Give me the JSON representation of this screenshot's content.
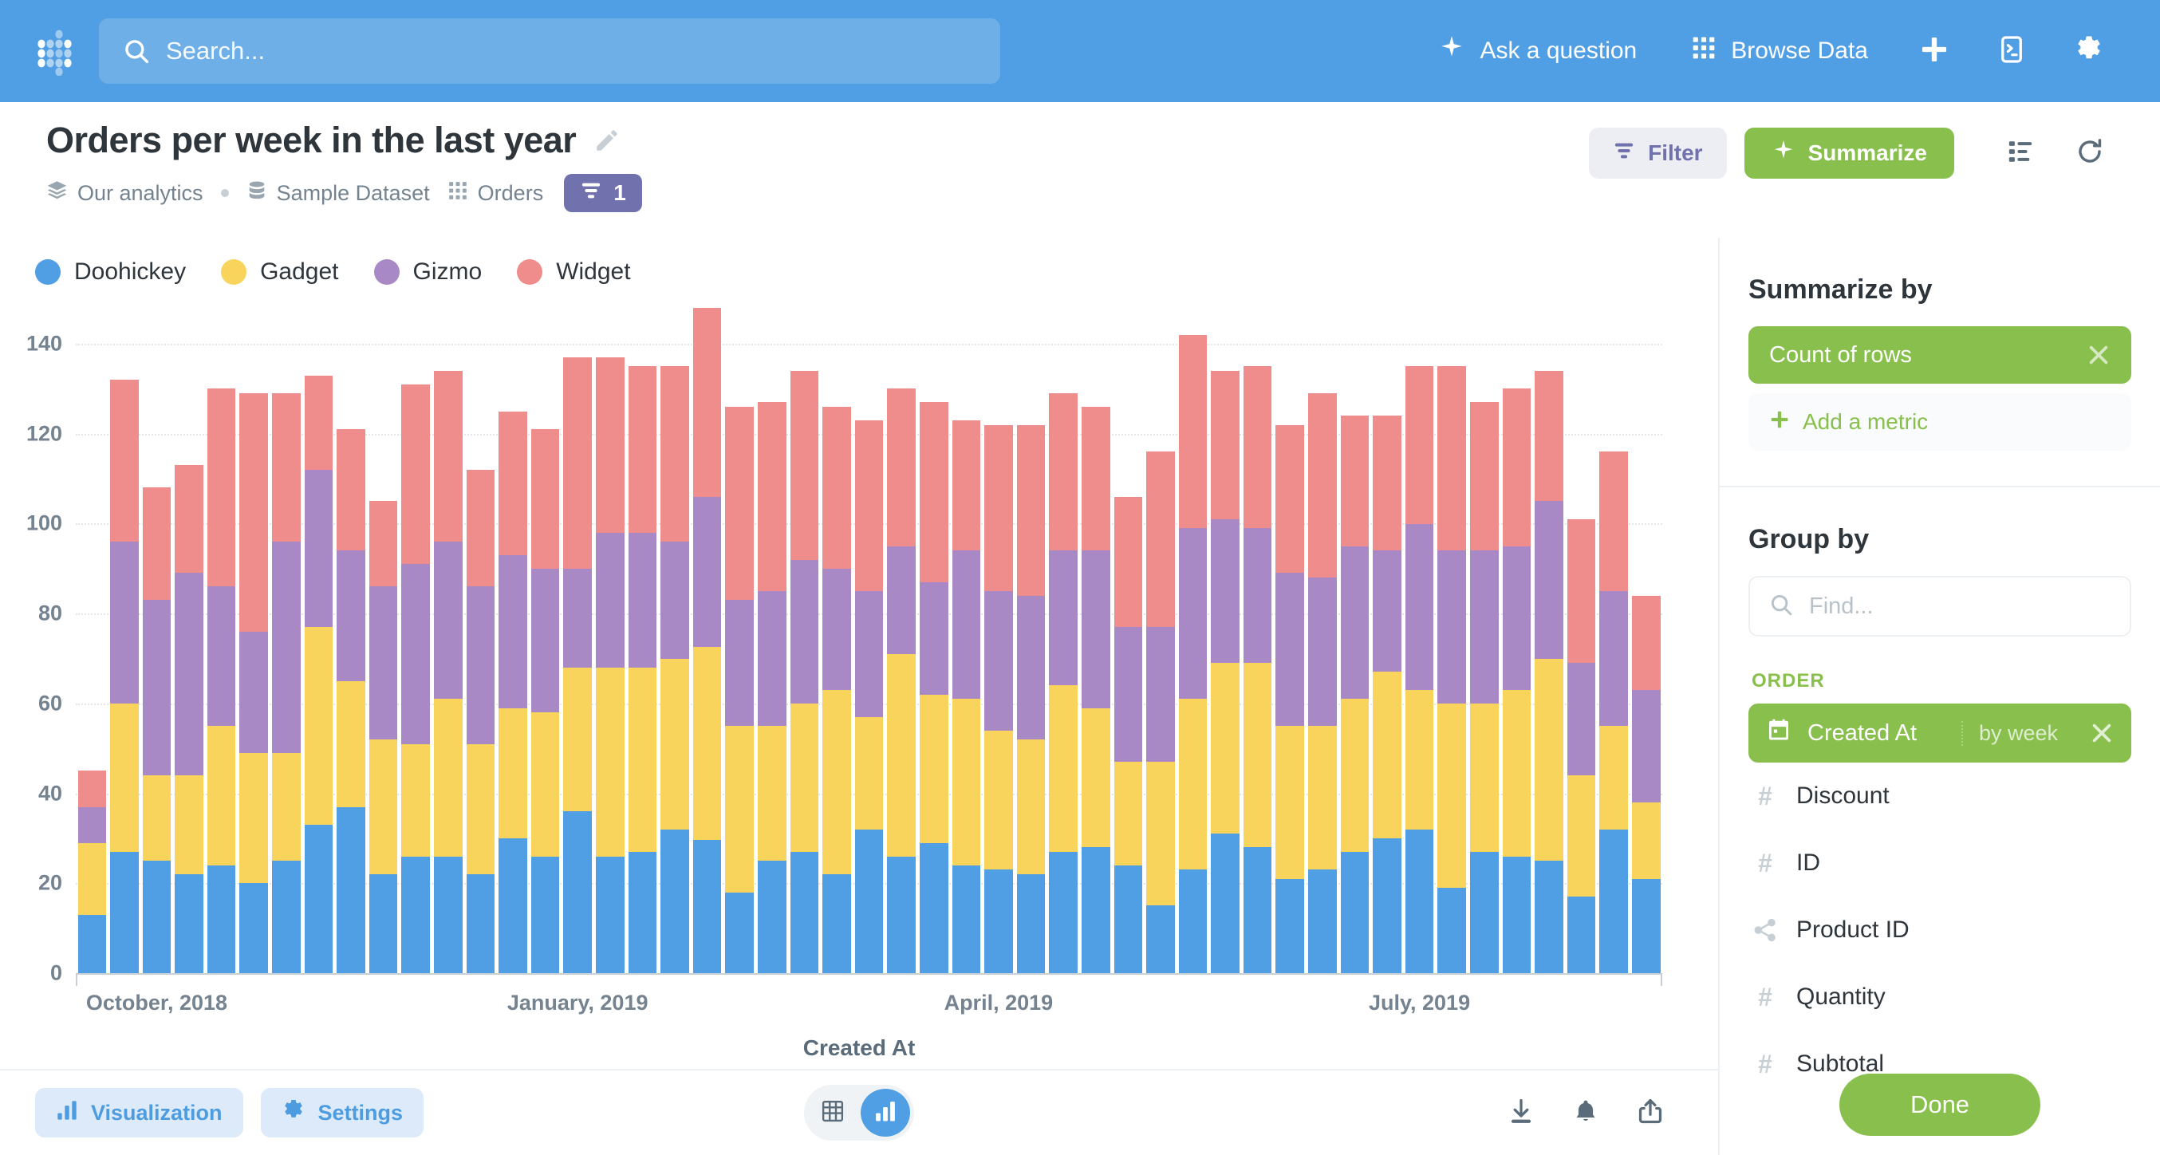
{
  "navbar": {
    "logo_icon": "metabase-dots-logo",
    "search": {
      "placeholder": "Search...",
      "value": "",
      "icon": "search-icon"
    },
    "ask_question": {
      "label": "Ask a question",
      "icon": "sparkle-icon"
    },
    "browse_data": {
      "label": "Browse Data",
      "icon": "grid-icon"
    },
    "new_icon": "plus-icon",
    "sql_icon": "console-icon",
    "settings_icon": "gear-icon",
    "bg_color": "#509EE3"
  },
  "header": {
    "title": "Orders per week in the last year",
    "edit_icon": "pencil-icon",
    "breadcrumbs": [
      {
        "label": "Our analytics",
        "icon": "collection-icon"
      },
      {
        "label": "Sample Dataset",
        "icon": "database-icon"
      },
      {
        "label": "Orders",
        "icon": "table-icon"
      }
    ],
    "filter_badge": {
      "count": "1",
      "icon": "filter-icon",
      "color": "#7172AD"
    },
    "filter_button": {
      "label": "Filter",
      "icon": "filter-icon"
    },
    "summarize_button": {
      "label": "Summarize",
      "icon": "sparkle-icon",
      "color": "#88BF4D"
    },
    "notebook_icon": "notebook-icon",
    "refresh_icon": "refresh-icon"
  },
  "chart_data": {
    "type": "bar",
    "stacked": true,
    "title": "",
    "xlabel": "Created At",
    "ylabel": "",
    "ylim": [
      0,
      148
    ],
    "yticks": [
      0,
      20,
      40,
      60,
      80,
      100,
      120,
      140
    ],
    "grid": true,
    "legend_position": "top-left",
    "xtick_labels": [
      "October, 2018",
      "January, 2019",
      "April, 2019",
      "July, 2019"
    ],
    "xtick_positions": [
      2,
      15,
      28,
      41
    ],
    "series": [
      {
        "name": "Doohickey",
        "color": "#509EE3",
        "values": [
          13,
          27,
          25,
          22,
          24,
          20,
          25,
          33,
          37,
          22,
          26,
          26,
          22,
          30,
          26,
          36,
          26,
          27,
          32,
          31,
          18,
          25,
          27,
          22,
          32,
          26,
          29,
          24,
          23,
          22,
          27,
          28,
          24,
          15,
          23,
          31,
          28,
          21,
          23,
          27,
          30,
          32,
          19,
          27,
          26,
          25,
          17,
          32,
          21
        ]
      },
      {
        "name": "Gadget",
        "color": "#F9D45C",
        "values": [
          16,
          33,
          19,
          22,
          31,
          29,
          24,
          44,
          28,
          30,
          25,
          35,
          29,
          29,
          32,
          32,
          42,
          41,
          38,
          45,
          37,
          30,
          33,
          41,
          25,
          45,
          33,
          37,
          31,
          30,
          37,
          31,
          23,
          32,
          38,
          38,
          41,
          34,
          32,
          34,
          37,
          31,
          41,
          33,
          37,
          45,
          27,
          23,
          17
        ]
      },
      {
        "name": "Gizmo",
        "color": "#A989C5",
        "values": [
          8,
          36,
          39,
          45,
          31,
          27,
          47,
          35,
          29,
          34,
          40,
          35,
          35,
          34,
          32,
          22,
          30,
          30,
          26,
          35,
          28,
          30,
          32,
          27,
          28,
          24,
          25,
          33,
          31,
          32,
          30,
          35,
          30,
          30,
          38,
          32,
          30,
          34,
          33,
          34,
          27,
          37,
          34,
          34,
          32,
          35,
          25,
          30,
          25
        ]
      },
      {
        "name": "Widget",
        "color": "#EF8C8C",
        "values": [
          8,
          36,
          25,
          24,
          44,
          53,
          33,
          21,
          27,
          19,
          40,
          38,
          26,
          32,
          31,
          47,
          39,
          37,
          39,
          44,
          43,
          42,
          42,
          36,
          38,
          35,
          40,
          29,
          37,
          38,
          35,
          32,
          29,
          39,
          43,
          33,
          36,
          33,
          41,
          29,
          30,
          35,
          41,
          33,
          35,
          29,
          32,
          31,
          21
        ]
      }
    ]
  },
  "bottombar": {
    "visualization_button": {
      "label": "Visualization",
      "icon": "bar-chart-icon"
    },
    "settings_button": {
      "label": "Settings",
      "icon": "gear-icon"
    },
    "toggle": {
      "table_icon": "table-icon",
      "chart_icon": "bar-chart-icon",
      "active": "chart"
    },
    "download_icon": "download-icon",
    "alert_icon": "bell-icon",
    "share_icon": "share-icon"
  },
  "sidebar": {
    "summarize_by": {
      "title": "Summarize by",
      "metric": {
        "label": "Count of rows",
        "remove_icon": "close-icon"
      },
      "add_metric": {
        "label": "Add a metric",
        "icon": "plus-icon"
      }
    },
    "group_by": {
      "title": "Group by",
      "search": {
        "placeholder": "Find...",
        "value": "",
        "icon": "search-icon"
      },
      "table_label": "ORDER",
      "selected": {
        "label": "Created At",
        "binning": "by week",
        "icon": "calendar-icon",
        "remove_icon": "close-icon"
      },
      "fields": [
        {
          "label": "Discount",
          "icon": "hash-icon"
        },
        {
          "label": "ID",
          "icon": "hash-icon"
        },
        {
          "label": "Product ID",
          "icon": "share-node-icon"
        },
        {
          "label": "Quantity",
          "icon": "hash-icon"
        },
        {
          "label": "Subtotal",
          "icon": "hash-icon"
        }
      ]
    },
    "done_button": {
      "label": "Done",
      "color": "#88BF4D"
    }
  }
}
